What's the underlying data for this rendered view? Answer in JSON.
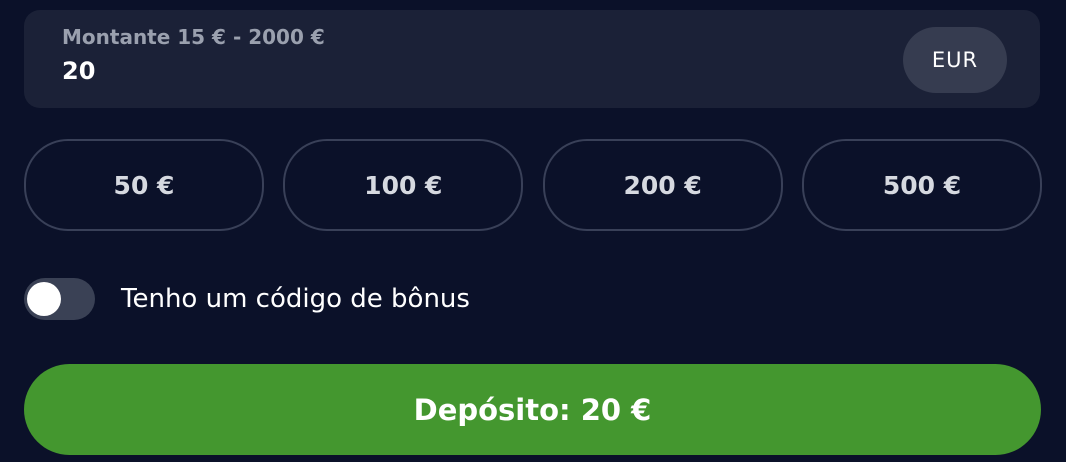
{
  "amount": {
    "label": "Montante 15 € - 2000 €",
    "value": "20",
    "currency": "EUR"
  },
  "presets": [
    "50 €",
    "100 €",
    "200 €",
    "500 €"
  ],
  "bonus": {
    "label": "Tenho um código de bônus",
    "enabled": false
  },
  "deposit": {
    "label": "Depósito: 20 €"
  },
  "colors": {
    "background": "#0b1129",
    "input_bg": "#1b2137",
    "pill_bg": "#363c50",
    "preset_border": "#394058",
    "toggle_bg": "#3a4155",
    "accent_green": "#44972f"
  },
  "icons": {
    "toggle": "toggle-switch-icon"
  }
}
